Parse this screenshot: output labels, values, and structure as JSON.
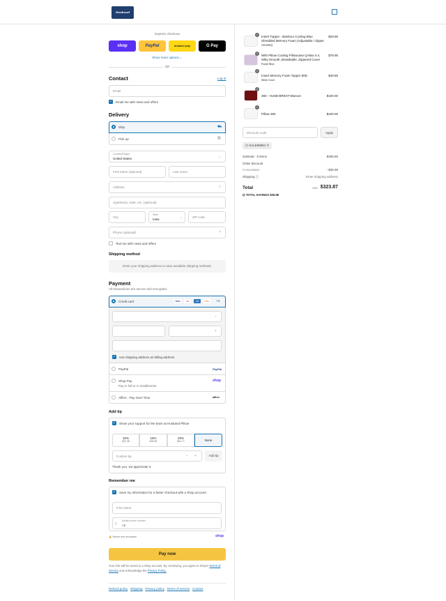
{
  "header": {
    "logo_text": "Husband Pillow"
  },
  "express": {
    "title": "Express checkout",
    "shop": "shop",
    "paypal": "PayPal",
    "amazon": "amazon pay",
    "gpay": "G Pay",
    "more": "Show more options ⌄",
    "or": "OR"
  },
  "contact": {
    "title": "Contact",
    "login": "Log in",
    "email_placeholder": "Email",
    "news": "Email me with news and offers"
  },
  "delivery": {
    "title": "Delivery",
    "ship": "Ship",
    "pickup": "Pick up",
    "country_label": "Country/Region",
    "country": "United States",
    "first": "First name (optional)",
    "last": "Last name",
    "address": "Address",
    "apt": "Apartment, suite, etc. (optional)",
    "city": "City",
    "state_label": "State",
    "state": "Iowa",
    "zip": "ZIP code",
    "phone": "Phone (optional)",
    "text_me": "Text me with news and offers"
  },
  "shipping": {
    "title": "Shipping method",
    "message": "Enter your shipping address to view available shipping methods."
  },
  "payment": {
    "title": "Payment",
    "subtitle": "All transactions are secure and encrypted.",
    "credit": "Credit card",
    "more_cards": "+4",
    "billing": "Use shipping address as billing address",
    "paypal": "PayPal",
    "paypal_logo": "PayPal",
    "shoppay": "Shop Pay",
    "shoppay_sub": "Pay in full or in installments",
    "shoppay_logo": "shop",
    "affirm": "Affirm - Pay Over Time",
    "affirm_logo": "affirm"
  },
  "tip": {
    "title": "Add tip",
    "support": "Show your support for the team at Husband Pillow",
    "options": [
      {
        "pct": "10%",
        "amt": "$32.38"
      },
      {
        "pct": "15%",
        "amt": "$48.58"
      },
      {
        "pct": "20%",
        "amt": "$64.77"
      },
      {
        "pct": "None",
        "amt": ""
      }
    ],
    "custom": "Custom tip",
    "add": "Add tip",
    "thanks": "Thank you, we appreciate it."
  },
  "remember": {
    "title": "Remember me",
    "save": "Save my information for a faster checkout with a Shop account",
    "first": "First name",
    "mobile_label": "Mobile phone number",
    "mobile": "+1",
    "secure": "Secure and encrypted",
    "shop": "shop"
  },
  "pay": {
    "label": "Pay now",
    "note1": "Your info will be saved to a Shop account. By continuing, you agree to Shop's",
    "tos": "Terms of Service",
    "note2": "and acknowledge the",
    "privacy": "Privacy Policy."
  },
  "footer": [
    "Refund policy",
    "Shipping",
    "Privacy policy",
    "Terms of service",
    "Contact"
  ],
  "summary": {
    "items": [
      {
        "qty": "1",
        "name": "Insert Topper - Bamboo Cooling Blue Shredded Memory Foam (Adjustable / Zipper Access)",
        "variant": "",
        "price": "$29.95"
      },
      {
        "qty": "1",
        "name": "Wife Pillow Cooling Pillowcase Q-Max 0.4, Silky-Smooth, Breathable, Zippered Cover",
        "variant": "Purple Bliss",
        "price": "$79.95"
      },
      {
        "qty": "1",
        "name": "Insert Memory Foam Topper 80D",
        "variant": "White Cover",
        "price": "$49.95"
      },
      {
        "qty": "1",
        "name": "360 - HUSB-BREST-Maroon",
        "variant": "",
        "price": "$100.00"
      },
      {
        "qty": "1",
        "name": "Pillow 360",
        "variant": "",
        "price": "$100.00"
      }
    ],
    "discount_placeholder": "Discount code",
    "apply": "Apply",
    "code": "SALE96991",
    "subtotal_label": "Subtotal · 5 items",
    "subtotal": "$359.85",
    "order_discount": "Order discount",
    "discount_code": "SALE96991",
    "discount_amt": "- $35.98",
    "shipping_label": "Shipping",
    "shipping_val": "Enter shipping address",
    "total_label": "Total",
    "currency": "USD",
    "total": "$323.87",
    "savings_label": "TOTAL SAVINGS",
    "savings": "$35.98"
  }
}
